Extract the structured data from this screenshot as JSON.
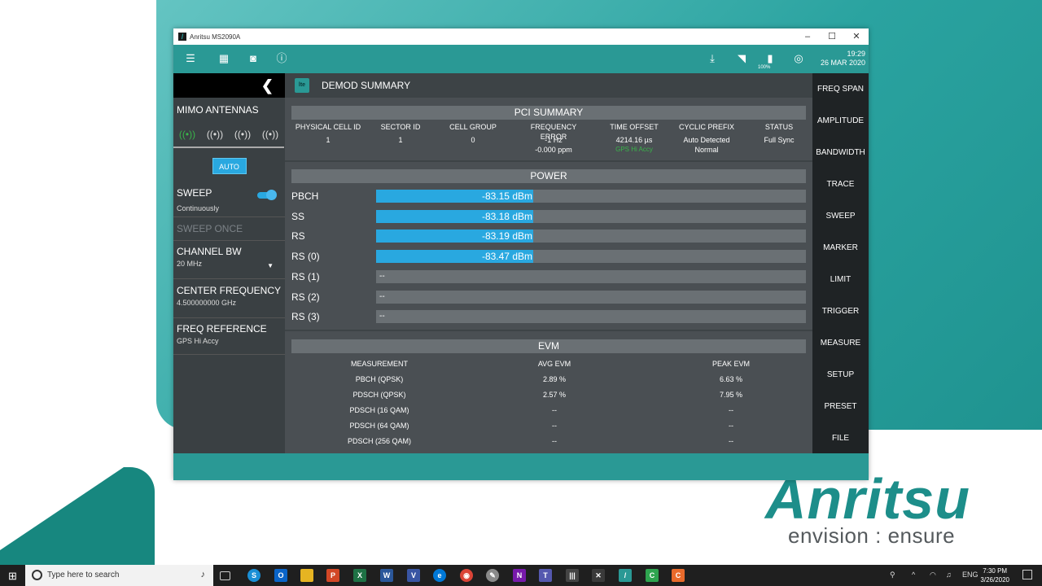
{
  "desktop": {
    "brand_word": "Anritsu",
    "brand_tagline": "envision : ensure"
  },
  "window": {
    "title": "Anritsu MS2090A",
    "controls": {
      "minimize": "–",
      "maximize": "☐",
      "close": "✕"
    }
  },
  "toolbar": {
    "time": "19:29",
    "date": "26 MAR 2020",
    "battery": "100%"
  },
  "left_panel": {
    "mimo_title": "MIMO ANTENNAS",
    "auto_label": "AUTO",
    "sweep_label": "SWEEP",
    "sweep_value": "Continuously",
    "sweep_once_label": "SWEEP ONCE",
    "channel_bw_label": "CHANNEL BW",
    "channel_bw_value": "20 MHz",
    "center_freq_label": "CENTER FREQUENCY",
    "center_freq_value": "4.500000000 GHz",
    "freq_ref_label": "FREQ REFERENCE",
    "freq_ref_value": "GPS Hi Accy"
  },
  "content": {
    "header_title": "DEMOD SUMMARY",
    "lte_badge": "lte",
    "pci_summary": {
      "title": "PCI SUMMARY",
      "columns": [
        "PHYSICAL CELL ID",
        "SECTOR ID",
        "CELL GROUP",
        "FREQUENCY ERROR",
        "TIME OFFSET",
        "CYCLIC PREFIX",
        "STATUS"
      ],
      "values": [
        "1",
        "1",
        "0",
        "-1 Hz",
        "4214.16 µs",
        "Auto Detected",
        "Full Sync"
      ],
      "values_line2": [
        "",
        "",
        "",
        "-0.000 ppm",
        "GPS Hi Accy",
        "Normal",
        ""
      ]
    },
    "power": {
      "title": "POWER",
      "rows": [
        {
          "label": "PBCH",
          "value": "-83.15 dBm",
          "fill": 0.365
        },
        {
          "label": "SS",
          "value": "-83.18 dBm",
          "fill": 0.365
        },
        {
          "label": "RS",
          "value": "-83.19 dBm",
          "fill": 0.365
        },
        {
          "label": "RS (0)",
          "value": "-83.47 dBm",
          "fill": 0.365
        },
        {
          "label": "RS (1)",
          "value": "--",
          "fill": 0
        },
        {
          "label": "RS (2)",
          "value": "--",
          "fill": 0
        },
        {
          "label": "RS (3)",
          "value": "--",
          "fill": 0
        }
      ]
    },
    "evm": {
      "title": "EVM",
      "headers": [
        "MEASUREMENT",
        "AVG EVM",
        "PEAK EVM"
      ],
      "rows": [
        [
          "PBCH (QPSK)",
          "2.89 %",
          "6.63 %"
        ],
        [
          "PDSCH (QPSK)",
          "2.57 %",
          "7.95 %"
        ],
        [
          "PDSCH (16 QAM)",
          "--",
          "--"
        ],
        [
          "PDSCH (64 QAM)",
          "--",
          "--"
        ],
        [
          "PDSCH (256 QAM)",
          "--",
          "--"
        ]
      ]
    }
  },
  "right_menu": [
    "FREQ SPAN",
    "AMPLITUDE",
    "BANDWIDTH",
    "TRACE",
    "SWEEP",
    "MARKER",
    "LIMIT",
    "TRIGGER",
    "MEASURE",
    "SETUP",
    "PRESET",
    "FILE"
  ],
  "taskbar": {
    "search_placeholder": "Type here to search",
    "language": "ENG",
    "time": "7:30 PM",
    "date": "3/26/2020"
  },
  "colors": {
    "teal": "#2a9995",
    "bar_blue": "#29a8e0",
    "green": "#39b54a"
  }
}
